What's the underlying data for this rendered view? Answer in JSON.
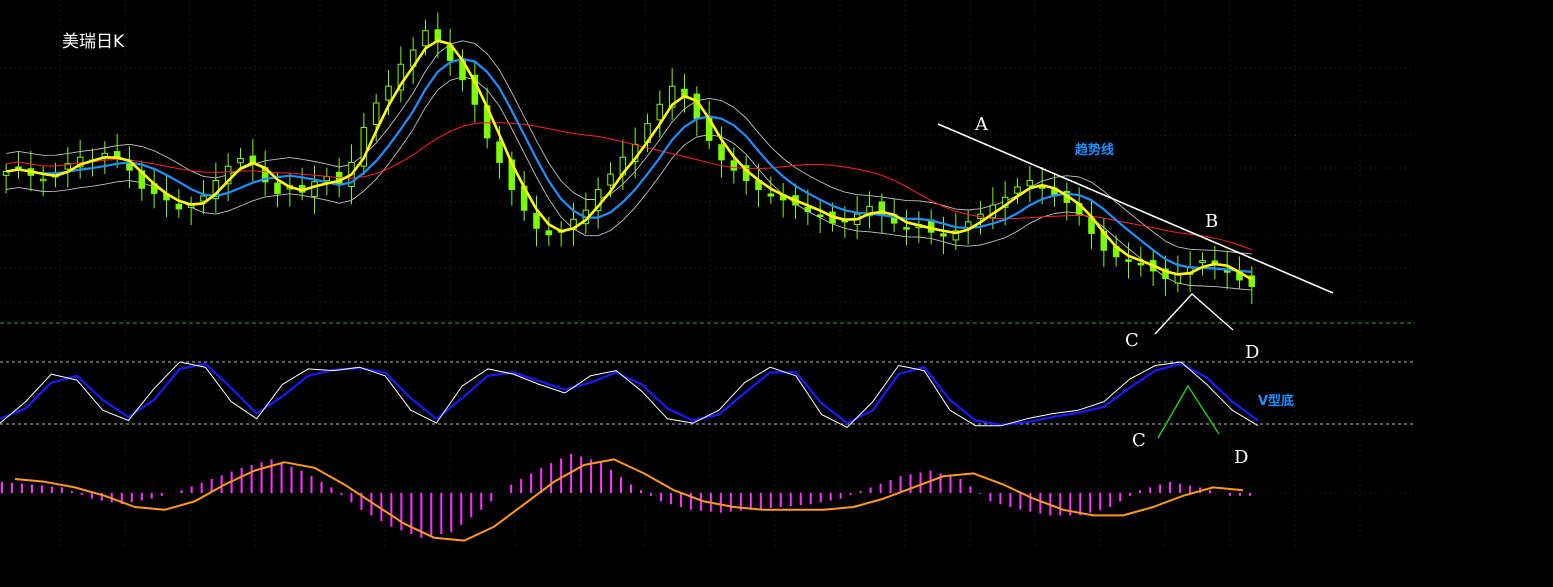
{
  "title": "美瑞日K",
  "annotations": {
    "trend_label": "趋势线",
    "v_bottom_label": "V型底",
    "point_a": "A",
    "point_b": "B",
    "point_c_price": "C",
    "point_d_price": "D",
    "point_c_kdj": "C",
    "point_d_kdj": "D"
  },
  "colors": {
    "background": "#000000",
    "bull_candle": "#7cfc00",
    "bear_candle": "#7cfc00",
    "ma_fast": "#ffff00",
    "ma_mid": "#1e90ff",
    "ma_slow": "#ff2020",
    "band": "#c0c0c0",
    "k_line": "#ffffff",
    "d_line": "#1a1aff",
    "macd_hist": "#ff33ff",
    "macd_line": "#ff9a1a",
    "trendline": "#ffffff",
    "pattern_price": "#ffffff",
    "pattern_kdj": "#22cc22",
    "annotation_blue": "#1e90ff"
  },
  "chart_data": {
    "type": "candlestick",
    "panels": [
      "price",
      "kdj",
      "macd"
    ],
    "price_series": [
      {
        "name": "",
        "key": "close",
        "values": [
          47.5,
          47.8,
          47.2,
          46.9,
          47.4,
          48.1,
          48.6,
          48.3,
          48.9,
          48.5,
          47.6,
          46.2,
          45.8,
          45.3,
          44.6,
          44.9,
          45.6,
          46.8,
          47.9,
          48.5,
          48.1,
          46.7,
          45.8,
          46.4,
          45.9,
          46.7,
          47.1,
          46.5,
          48.2,
          50.9,
          52.8,
          54.1,
          55.8,
          56.9,
          58.4,
          57.6,
          56.1,
          54.6,
          52.7,
          50.1,
          48.2,
          46.1,
          44.5,
          43.1,
          42.6,
          42.9,
          43.8,
          44.5,
          46.1,
          47.3,
          48.6,
          49.6,
          51.2,
          52.7,
          54.1,
          53.2,
          51.6,
          49.9,
          48.4,
          47.6,
          46.8,
          46.1,
          45.6,
          45.3,
          44.9,
          44.4,
          44.1,
          43.5,
          43.7,
          44.2,
          44.8,
          44.1,
          43.5,
          43.1,
          43.4,
          42.8,
          42.5,
          42.9,
          43.6,
          44.2,
          44.9,
          45.5,
          46.3,
          46.8,
          46.2,
          45.6,
          45.1,
          44.2,
          42.7,
          41.4,
          40.9,
          40.6,
          40.3,
          39.8,
          39.2,
          39.6,
          40.1,
          40.6,
          40.3,
          39.7,
          39.1,
          38.6
        ]
      }
    ],
    "ma_series": [
      {
        "name": "",
        "key": "ma_fast"
      },
      {
        "name": "",
        "key": "ma_mid"
      },
      {
        "name": "",
        "key": "ma_slow"
      },
      {
        "name": "",
        "key": "band_upper"
      },
      {
        "name": "",
        "key": "band_lower"
      }
    ],
    "kdj": {
      "k": [
        15,
        40,
        72,
        65,
        30,
        18,
        55,
        86,
        80,
        40,
        20,
        60,
        78,
        76,
        80,
        70,
        30,
        15,
        58,
        78,
        72,
        60,
        50,
        70,
        76,
        52,
        20,
        15,
        30,
        62,
        80,
        70,
        25,
        10,
        40,
        82,
        76,
        30,
        12,
        12,
        20,
        26,
        30,
        40,
        66,
        82,
        86,
        60,
        30,
        12
      ],
      "d": [
        20,
        32,
        62,
        70,
        42,
        22,
        42,
        78,
        84,
        56,
        26,
        46,
        70,
        77,
        79,
        74,
        44,
        20,
        44,
        70,
        74,
        64,
        54,
        62,
        74,
        60,
        32,
        18,
        25,
        50,
        74,
        74,
        38,
        15,
        30,
        72,
        80,
        42,
        18,
        13,
        16,
        22,
        27,
        34,
        56,
        76,
        84,
        68,
        40,
        18
      ]
    },
    "macd": {
      "hist": [
        0.4,
        0.3,
        0.2,
        -0.2,
        -0.4,
        -0.2,
        0.1,
        0.5,
        0.9,
        1.2,
        0.8,
        0.2,
        -0.6,
        -1.2,
        -1.6,
        -1.4,
        -0.6,
        0.3,
        0.9,
        1.4,
        1.1,
        0.3,
        -0.3,
        -0.6,
        -0.7,
        -0.6,
        -0.5,
        -0.4,
        -0.2,
        0.2,
        0.6,
        0.8,
        0.5,
        -0.3,
        -0.6,
        -0.8,
        -0.8,
        -0.5,
        0.1,
        0.4,
        0.2,
        -0.1
      ],
      "signal": [
        0.5,
        0.4,
        0.2,
        -0.1,
        -0.5,
        -0.6,
        -0.3,
        0.3,
        0.8,
        1.1,
        0.9,
        0.3,
        -0.4,
        -1.1,
        -1.6,
        -1.7,
        -1.2,
        -0.4,
        0.4,
        1.0,
        1.2,
        0.7,
        0.1,
        -0.3,
        -0.5,
        -0.6,
        -0.6,
        -0.6,
        -0.5,
        -0.2,
        0.2,
        0.6,
        0.7,
        0.3,
        -0.2,
        -0.6,
        -0.8,
        -0.8,
        -0.5,
        -0.1,
        0.2,
        0.1
      ]
    },
    "kdj_reference_levels": [
      80,
      20
    ],
    "grid": true
  }
}
